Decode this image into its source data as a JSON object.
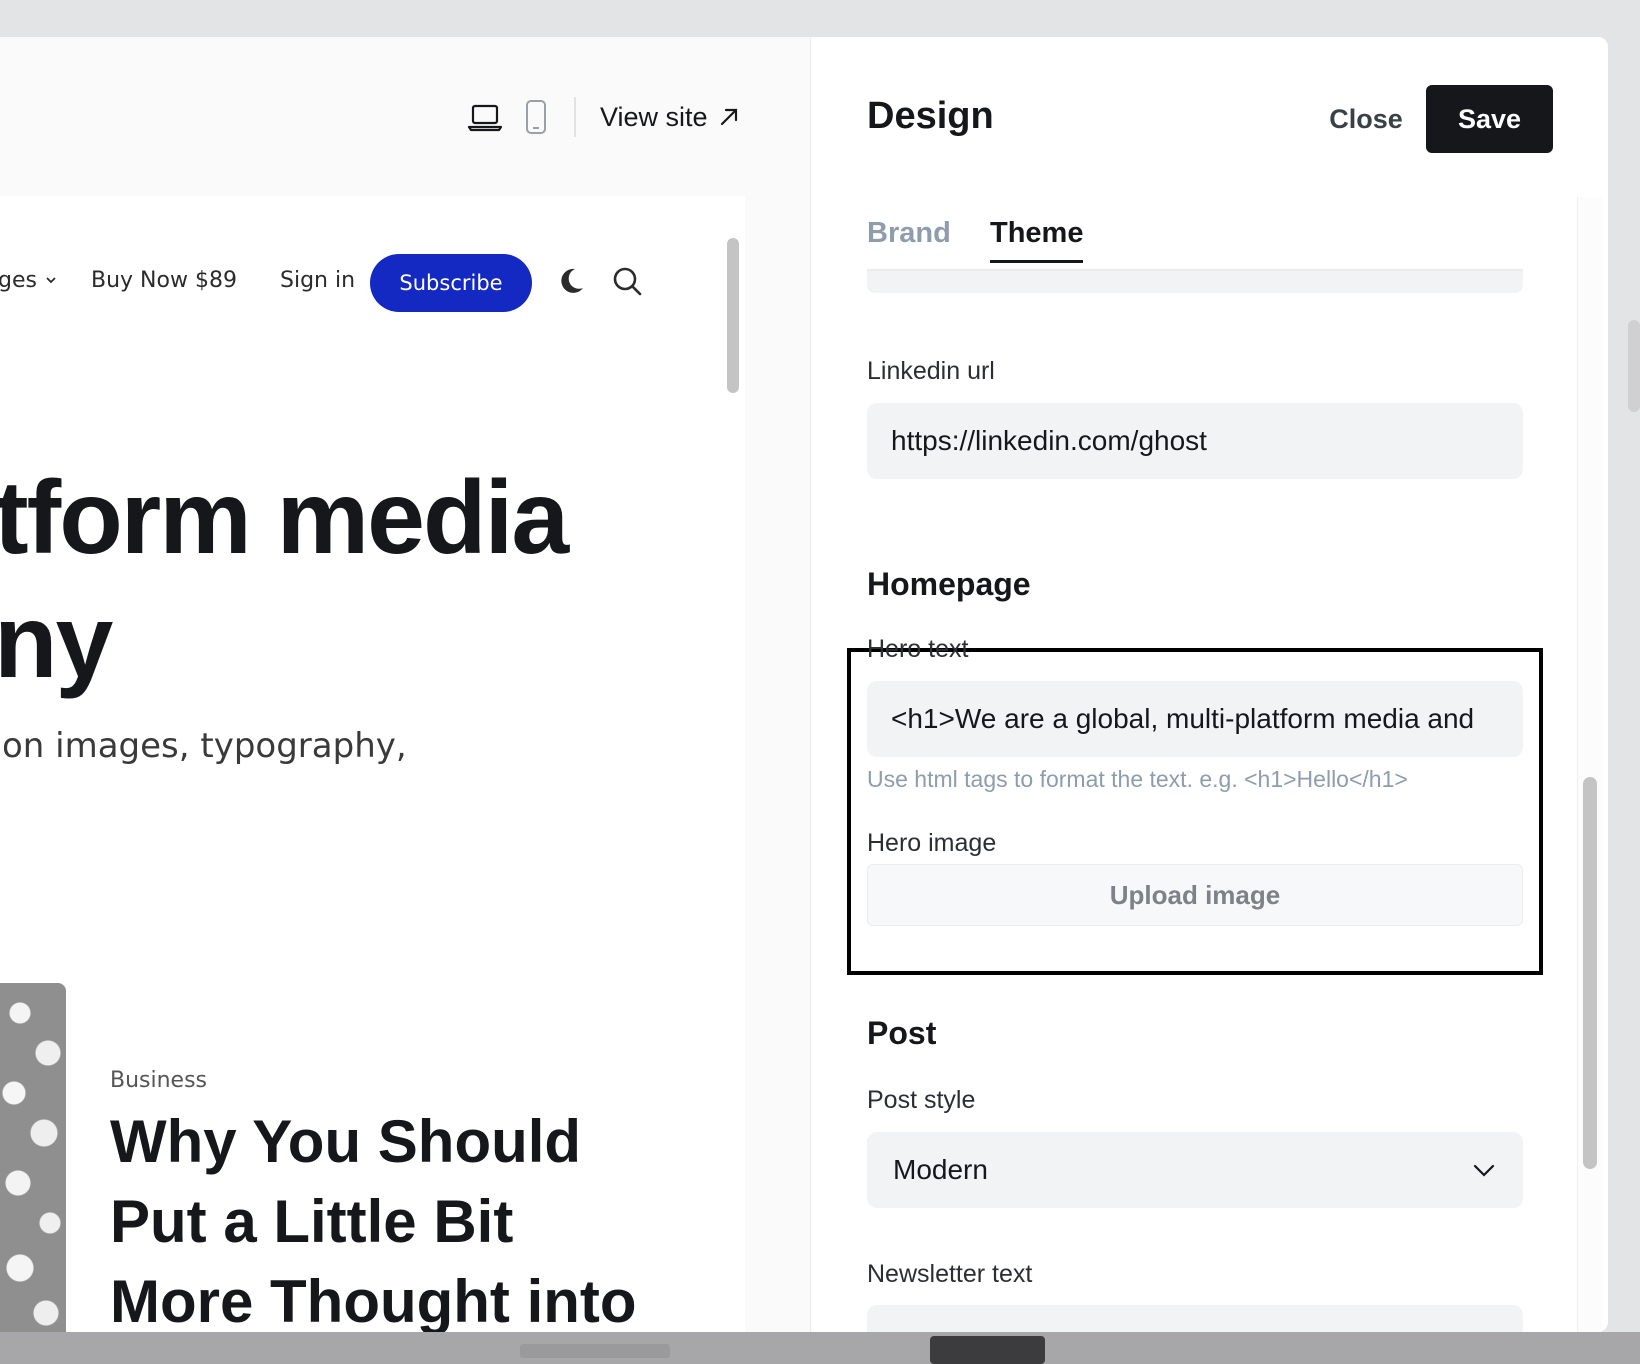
{
  "preview": {
    "toolbar": {
      "desktop_icon": "laptop-icon",
      "mobile_icon": "mobile-icon",
      "view_site_label": "View site"
    },
    "site": {
      "nav": {
        "pages_label": "ges",
        "buy_label": "Buy Now $89",
        "signin_label": "Sign in",
        "subscribe_label": "Subscribe",
        "accent_color": "#1428c2"
      },
      "hero_line1": "tform media",
      "hero_line2": "ny",
      "hero_subtitle": "on images, typography,",
      "post_tag": "Business",
      "post_title": "Why You Should Put a Little Bit More Thought into Your"
    }
  },
  "settings": {
    "title": "Design",
    "close_label": "Close",
    "save_label": "Save",
    "tabs": [
      {
        "label": "Brand",
        "active": false
      },
      {
        "label": "Theme",
        "active": true
      }
    ],
    "linkedin": {
      "label": "Linkedin url",
      "value": "https://linkedin.com/ghost"
    },
    "homepage": {
      "section_title": "Homepage",
      "hero_text_label": "Hero text",
      "hero_text_value": "<h1>We are a global, multi-platform media and",
      "hero_text_hint": "Use html tags to format the text. e.g. <h1>Hello</h1>",
      "hero_image_label": "Hero image",
      "upload_label": "Upload image"
    },
    "post": {
      "section_title": "Post",
      "post_style_label": "Post style",
      "post_style_value": "Modern",
      "newsletter_label": "Newsletter text"
    }
  },
  "colors": {
    "save_bg": "#15171a",
    "tab_inactive": "#8e9cac",
    "highlight_border": "#000000"
  }
}
